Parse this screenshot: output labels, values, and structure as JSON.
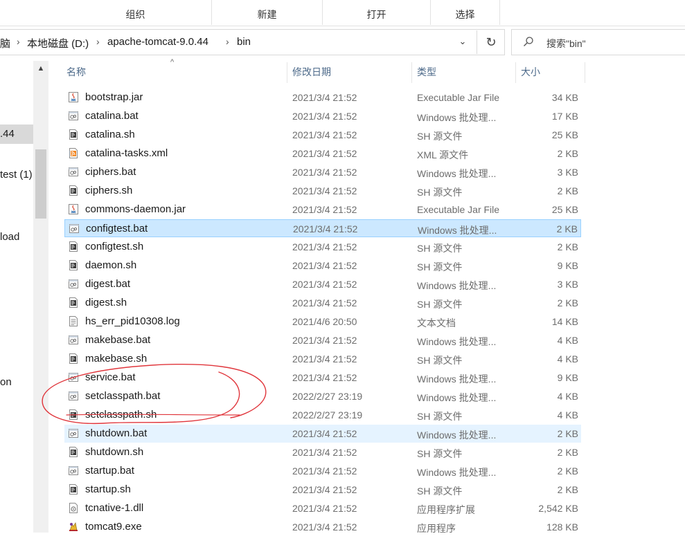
{
  "ribbon": {
    "groups": [
      {
        "label": "组织"
      },
      {
        "label": "新建"
      },
      {
        "label": "打开"
      },
      {
        "label": "选择"
      }
    ]
  },
  "address": {
    "crumbs": [
      "脑",
      "本地磁盘 (D:)",
      "apache-tomcat-9.0.44",
      "bin"
    ],
    "dropdown_glyph": "⌄",
    "refresh_glyph": "↻"
  },
  "search": {
    "placeholder": "搜索\"bin\"",
    "icon": "search-icon"
  },
  "nav": {
    "items": [
      {
        "label": ".44",
        "selected": true
      },
      {
        "label": "test (1)",
        "selected": false
      },
      {
        "label": "load",
        "selected": false
      },
      {
        "label": "on",
        "selected": false
      }
    ]
  },
  "columns": {
    "name": "名称",
    "date": "修改日期",
    "type": "类型",
    "size": "大小"
  },
  "files": [
    {
      "name": "bootstrap.jar",
      "date": "2021/3/4 21:52",
      "type": "Executable Jar File",
      "size": "34 KB",
      "icon": "jar",
      "state": ""
    },
    {
      "name": "catalina.bat",
      "date": "2021/3/4 21:52",
      "type": "Windows 批处理...",
      "size": "17 KB",
      "icon": "bat",
      "state": ""
    },
    {
      "name": "catalina.sh",
      "date": "2021/3/4 21:52",
      "type": "SH 源文件",
      "size": "25 KB",
      "icon": "sh",
      "state": ""
    },
    {
      "name": "catalina-tasks.xml",
      "date": "2021/3/4 21:52",
      "type": "XML 源文件",
      "size": "2 KB",
      "icon": "xml",
      "state": ""
    },
    {
      "name": "ciphers.bat",
      "date": "2021/3/4 21:52",
      "type": "Windows 批处理...",
      "size": "3 KB",
      "icon": "bat",
      "state": ""
    },
    {
      "name": "ciphers.sh",
      "date": "2021/3/4 21:52",
      "type": "SH 源文件",
      "size": "2 KB",
      "icon": "sh",
      "state": ""
    },
    {
      "name": "commons-daemon.jar",
      "date": "2021/3/4 21:52",
      "type": "Executable Jar File",
      "size": "25 KB",
      "icon": "jar",
      "state": ""
    },
    {
      "name": "configtest.bat",
      "date": "2021/3/4 21:52",
      "type": "Windows 批处理...",
      "size": "2 KB",
      "icon": "bat",
      "state": "selected"
    },
    {
      "name": "configtest.sh",
      "date": "2021/3/4 21:52",
      "type": "SH 源文件",
      "size": "2 KB",
      "icon": "sh",
      "state": ""
    },
    {
      "name": "daemon.sh",
      "date": "2021/3/4 21:52",
      "type": "SH 源文件",
      "size": "9 KB",
      "icon": "sh",
      "state": ""
    },
    {
      "name": "digest.bat",
      "date": "2021/3/4 21:52",
      "type": "Windows 批处理...",
      "size": "3 KB",
      "icon": "bat",
      "state": ""
    },
    {
      "name": "digest.sh",
      "date": "2021/3/4 21:52",
      "type": "SH 源文件",
      "size": "2 KB",
      "icon": "sh",
      "state": ""
    },
    {
      "name": "hs_err_pid10308.log",
      "date": "2021/4/6 20:50",
      "type": "文本文档",
      "size": "14 KB",
      "icon": "txt",
      "state": ""
    },
    {
      "name": "makebase.bat",
      "date": "2021/3/4 21:52",
      "type": "Windows 批处理...",
      "size": "4 KB",
      "icon": "bat",
      "state": ""
    },
    {
      "name": "makebase.sh",
      "date": "2021/3/4 21:52",
      "type": "SH 源文件",
      "size": "4 KB",
      "icon": "sh",
      "state": ""
    },
    {
      "name": "service.bat",
      "date": "2021/3/4 21:52",
      "type": "Windows 批处理...",
      "size": "9 KB",
      "icon": "bat",
      "state": ""
    },
    {
      "name": "setclasspath.bat",
      "date": "2022/2/27 23:19",
      "type": "Windows 批处理...",
      "size": "4 KB",
      "icon": "bat",
      "state": ""
    },
    {
      "name": "setclasspath.sh",
      "date": "2022/2/27 23:19",
      "type": "SH 源文件",
      "size": "4 KB",
      "icon": "sh",
      "state": ""
    },
    {
      "name": "shutdown.bat",
      "date": "2021/3/4 21:52",
      "type": "Windows 批处理...",
      "size": "2 KB",
      "icon": "bat",
      "state": "hover"
    },
    {
      "name": "shutdown.sh",
      "date": "2021/3/4 21:52",
      "type": "SH 源文件",
      "size": "2 KB",
      "icon": "sh",
      "state": ""
    },
    {
      "name": "startup.bat",
      "date": "2021/3/4 21:52",
      "type": "Windows 批处理...",
      "size": "2 KB",
      "icon": "bat",
      "state": ""
    },
    {
      "name": "startup.sh",
      "date": "2021/3/4 21:52",
      "type": "SH 源文件",
      "size": "2 KB",
      "icon": "sh",
      "state": ""
    },
    {
      "name": "tcnative-1.dll",
      "date": "2021/3/4 21:52",
      "type": "应用程序扩展",
      "size": "2,542 KB",
      "icon": "dll",
      "state": ""
    },
    {
      "name": "tomcat9.exe",
      "date": "2021/3/4 21:52",
      "type": "应用程序",
      "size": "128 KB",
      "icon": "exe",
      "state": ""
    }
  ],
  "colors": {
    "selected_bg": "#cce8ff",
    "hover_bg": "#e5f3ff",
    "annotation_stroke": "#e0353b"
  }
}
